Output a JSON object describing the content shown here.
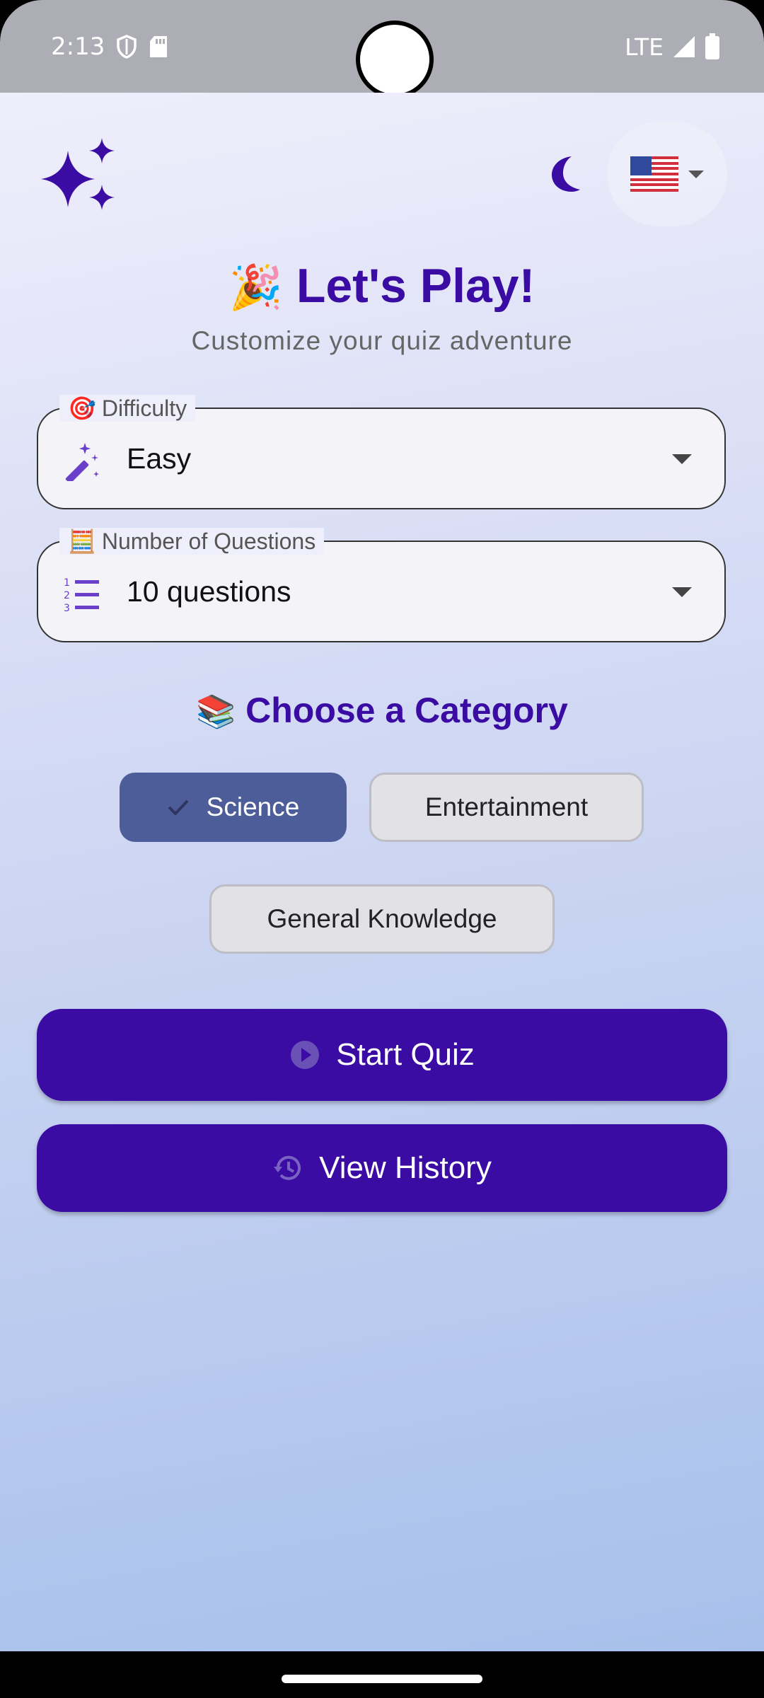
{
  "status_bar": {
    "time": "2:13",
    "network": "LTE"
  },
  "header": {
    "sparkle_icon": "sparkles-icon",
    "theme_icon": "moon-icon",
    "language": {
      "flag": "us-flag-icon",
      "expand_icon": "caret-down-icon"
    }
  },
  "hero": {
    "emoji": "🎉",
    "title": "Let's Play!",
    "subtitle": "Customize your quiz adventure"
  },
  "difficulty": {
    "label_emoji": "🎯",
    "label": "Difficulty",
    "icon": "magic-wand-icon",
    "value": "Easy"
  },
  "questions": {
    "label_emoji": "🧮",
    "label": "Number of Questions",
    "icon": "numbered-list-icon",
    "value": "10 questions"
  },
  "category": {
    "emoji": "📚",
    "title": "Choose a Category",
    "chips": [
      {
        "label": "Science",
        "selected": true
      },
      {
        "label": "Entertainment",
        "selected": false
      },
      {
        "label": "General Knowledge",
        "selected": false
      }
    ]
  },
  "actions": {
    "start_label": "Start Quiz",
    "start_icon": "play-circle-icon",
    "history_label": "View History",
    "history_icon": "history-icon"
  },
  "colors": {
    "primary": "#3a0ca3",
    "chip_selected": "#4c5d99",
    "chip_unselected": "#e2e2e6"
  }
}
